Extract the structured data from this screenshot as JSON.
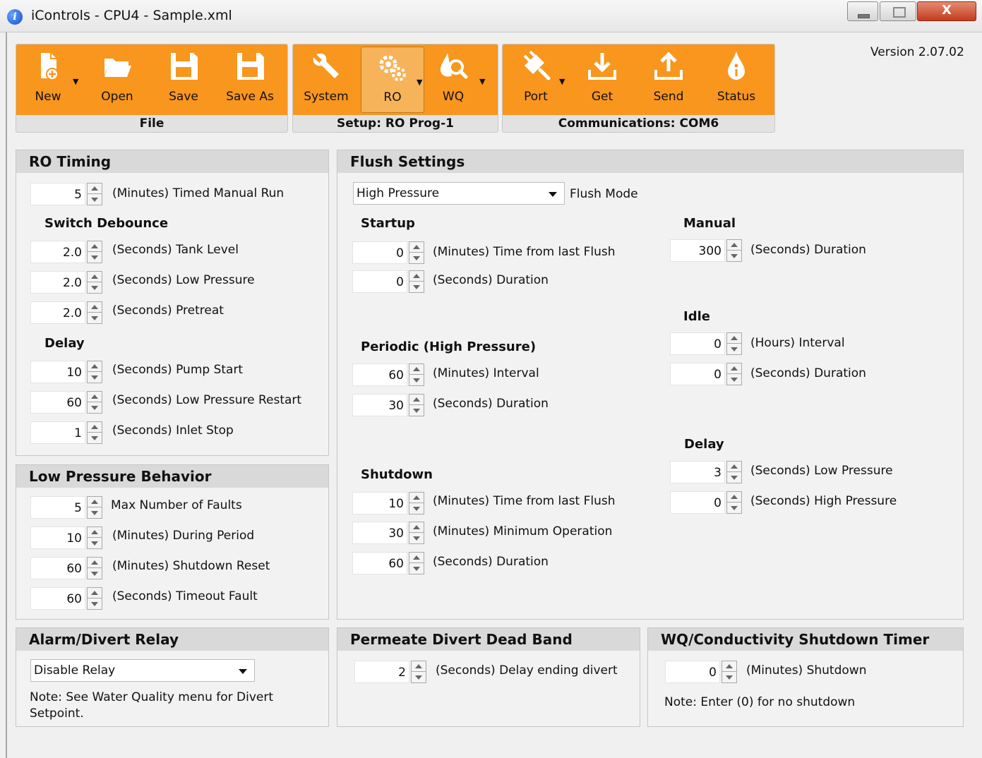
{
  "window": {
    "title": "iControls - CPU4 - Sample.xml",
    "close_glyph": "X"
  },
  "version": "Version 2.07.02",
  "ribbon": {
    "file": {
      "caption": "File",
      "buttons": [
        "New",
        "Open",
        "Save",
        "Save As"
      ]
    },
    "setup": {
      "caption": "Setup: RO Prog-1",
      "buttons": [
        "System",
        "RO",
        "WQ"
      ],
      "active": "RO"
    },
    "comms": {
      "caption": "Communications: COM6",
      "buttons": [
        "Port",
        "Get",
        "Send",
        "Status"
      ]
    },
    "colors": {
      "accent": "#f8961e",
      "active": "#f7b35a"
    }
  },
  "ro_timing": {
    "title": "RO Timing",
    "manual_run": {
      "value": "5",
      "label": "(Minutes) Timed Manual Run"
    },
    "switch_debounce": {
      "title": "Switch Debounce",
      "items": [
        {
          "value": "2.0",
          "label": "(Seconds) Tank Level"
        },
        {
          "value": "2.0",
          "label": "(Seconds) Low Pressure"
        },
        {
          "value": "2.0",
          "label": "(Seconds) Pretreat"
        }
      ]
    },
    "delay": {
      "title": "Delay",
      "items": [
        {
          "value": "10",
          "label": "(Seconds) Pump Start"
        },
        {
          "value": "60",
          "label": "(Seconds) Low Pressure Restart"
        },
        {
          "value": "1",
          "label": "(Seconds) Inlet Stop"
        }
      ]
    }
  },
  "low_pressure": {
    "title": "Low Pressure Behavior",
    "items": [
      {
        "value": "5",
        "label": "Max Number of Faults"
      },
      {
        "value": "10",
        "label": "(Minutes) During Period"
      },
      {
        "value": "60",
        "label": "(Minutes) Shutdown Reset"
      },
      {
        "value": "60",
        "label": "(Seconds) Timeout Fault"
      }
    ]
  },
  "flush": {
    "title": "Flush Settings",
    "mode": {
      "value": "High Pressure",
      "label": "Flush Mode"
    },
    "startup": {
      "title": "Startup",
      "items": [
        {
          "value": "0",
          "label": "(Minutes) Time from last Flush"
        },
        {
          "value": "0",
          "label": "(Seconds) Duration"
        }
      ]
    },
    "periodic": {
      "title": "Periodic (High Pressure)",
      "items": [
        {
          "value": "60",
          "label": "(Minutes) Interval"
        },
        {
          "value": "30",
          "label": "(Seconds) Duration"
        }
      ]
    },
    "shutdown": {
      "title": "Shutdown",
      "items": [
        {
          "value": "10",
          "label": "(Minutes) Time from last Flush"
        },
        {
          "value": "30",
          "label": "(Minutes) Minimum Operation"
        },
        {
          "value": "60",
          "label": "(Seconds) Duration"
        }
      ]
    },
    "manual": {
      "title": "Manual",
      "items": [
        {
          "value": "300",
          "label": "(Seconds) Duration"
        }
      ]
    },
    "idle": {
      "title": "Idle",
      "items": [
        {
          "value": "0",
          "label": "(Hours) Interval"
        },
        {
          "value": "0",
          "label": "(Seconds) Duration"
        }
      ]
    },
    "delay": {
      "title": "Delay",
      "items": [
        {
          "value": "3",
          "label": "(Seconds) Low Pressure"
        },
        {
          "value": "0",
          "label": "(Seconds) High Pressure"
        }
      ]
    }
  },
  "alarm": {
    "title": "Alarm/Divert Relay",
    "select": "Disable Relay",
    "note": "Note: See Water Quality menu for Divert Setpoint."
  },
  "permeate": {
    "title": "Permeate Divert Dead Band",
    "item": {
      "value": "2",
      "label": "(Seconds) Delay ending divert"
    }
  },
  "wq_timer": {
    "title": "WQ/Conductivity Shutdown Timer",
    "item": {
      "value": "0",
      "label": "(Minutes) Shutdown"
    },
    "note": "Note: Enter (0) for no shutdown"
  }
}
